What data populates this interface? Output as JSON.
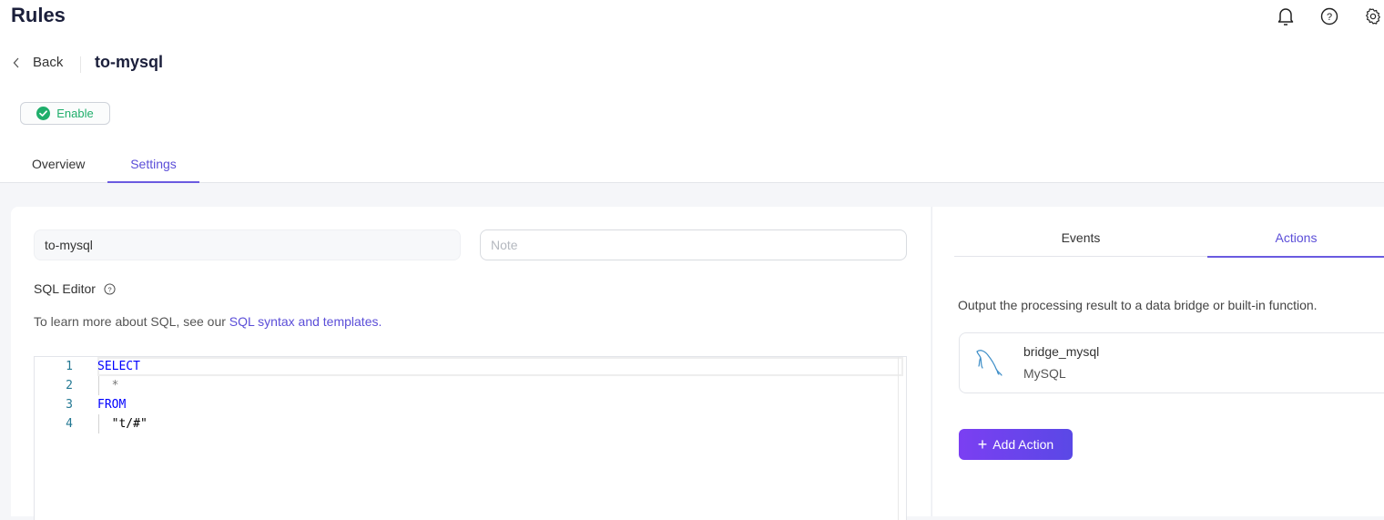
{
  "topbar": {
    "title": "Rules",
    "icons": [
      "bell-icon",
      "help-icon",
      "gear-icon"
    ]
  },
  "header": {
    "back_label": "Back",
    "rule_name": "to-mysql",
    "status_label": "Enable",
    "status_color": "#1fae6b",
    "tabs": [
      {
        "label": "Overview",
        "active": false
      },
      {
        "label": "Settings",
        "active": true
      }
    ]
  },
  "form": {
    "name_value": "to-mysql",
    "note_placeholder": "Note",
    "note_value": "",
    "sql_editor_label": "SQL Editor",
    "sql_hint_prefix": "To learn more about SQL, see our ",
    "sql_hint_link": "SQL syntax and templates."
  },
  "editor": {
    "lines": [
      {
        "number": "1",
        "text": "SELECT",
        "type": "keyword"
      },
      {
        "number": "2",
        "text": "  *",
        "type": "operator"
      },
      {
        "number": "3",
        "text": "FROM",
        "type": "keyword"
      },
      {
        "number": "4",
        "text": "  \"t/#\"",
        "type": "string"
      }
    ]
  },
  "side_panel": {
    "tabs": [
      {
        "label": "Events",
        "active": false
      },
      {
        "label": "Actions",
        "active": true
      }
    ],
    "description": "Output the processing result to a data bridge or built-in function.",
    "actions": [
      {
        "name": "bridge_mysql",
        "type": "MySQL",
        "icon": "mysql-dolphin-icon"
      }
    ],
    "add_action_label": "Add Action"
  },
  "colors": {
    "accent": "#5b4ed8",
    "button_gradient_start": "#7b3ff2",
    "button_gradient_end": "#5a48e6"
  }
}
